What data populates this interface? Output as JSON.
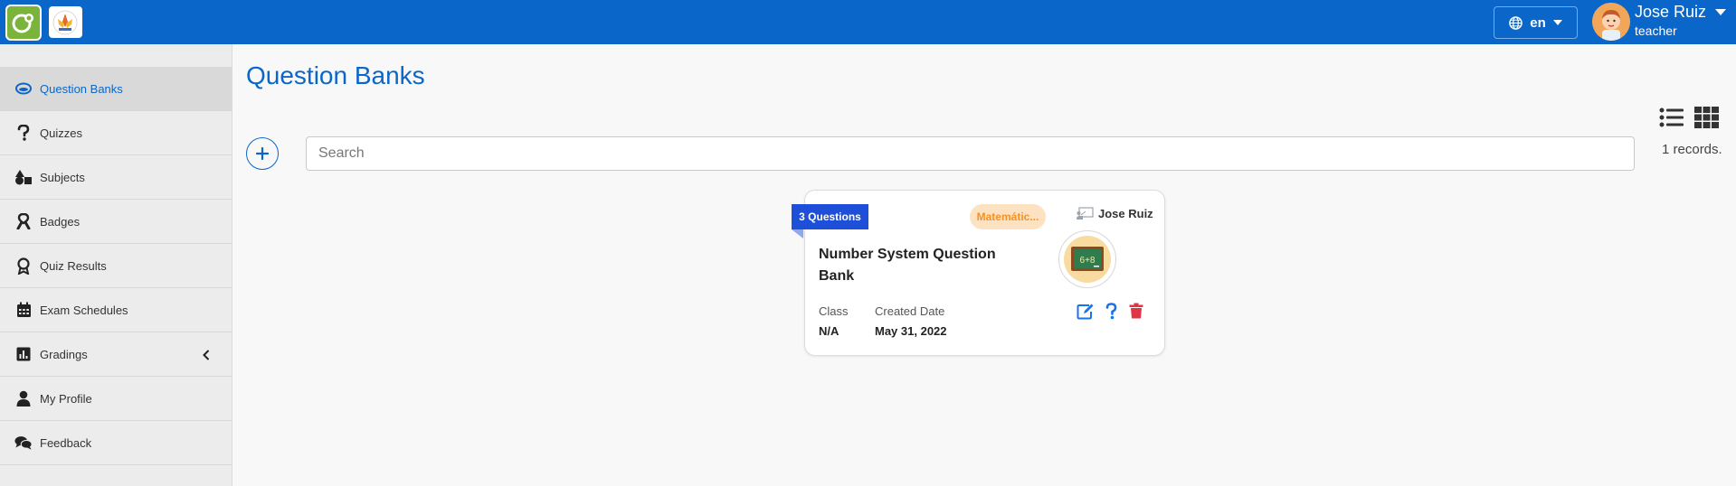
{
  "header": {
    "language": "en",
    "user_name": "Jose Ruiz",
    "user_role": "teacher",
    "colors": {
      "primary": "#0a67c9"
    }
  },
  "sidebar": {
    "items": [
      {
        "label": "Question Banks",
        "icon": "question-bank-icon",
        "active": true
      },
      {
        "label": "Quizzes",
        "icon": "question-mark-icon"
      },
      {
        "label": "Subjects",
        "icon": "shapes-icon"
      },
      {
        "label": "Badges",
        "icon": "ribbon-icon"
      },
      {
        "label": "Quiz Results",
        "icon": "award-icon"
      },
      {
        "label": "Exam Schedules",
        "icon": "calendar-icon"
      },
      {
        "label": "Gradings",
        "icon": "bar-chart-icon",
        "has_submenu": true
      },
      {
        "label": "My Profile",
        "icon": "user-icon"
      },
      {
        "label": "Feedback",
        "icon": "comments-icon"
      }
    ]
  },
  "main": {
    "title": "Question Banks",
    "search_placeholder": "Search",
    "records": "1 records.",
    "cards": [
      {
        "questions_count": "3 Questions",
        "subject": "Matemátic...",
        "author": "Jose Ruiz",
        "title": "Number System Question Bank",
        "class_label": "Class",
        "class_value": "N/A",
        "created_label": "Created Date",
        "created_value": "May 31, 2022",
        "image_text": "6+8"
      }
    ]
  }
}
